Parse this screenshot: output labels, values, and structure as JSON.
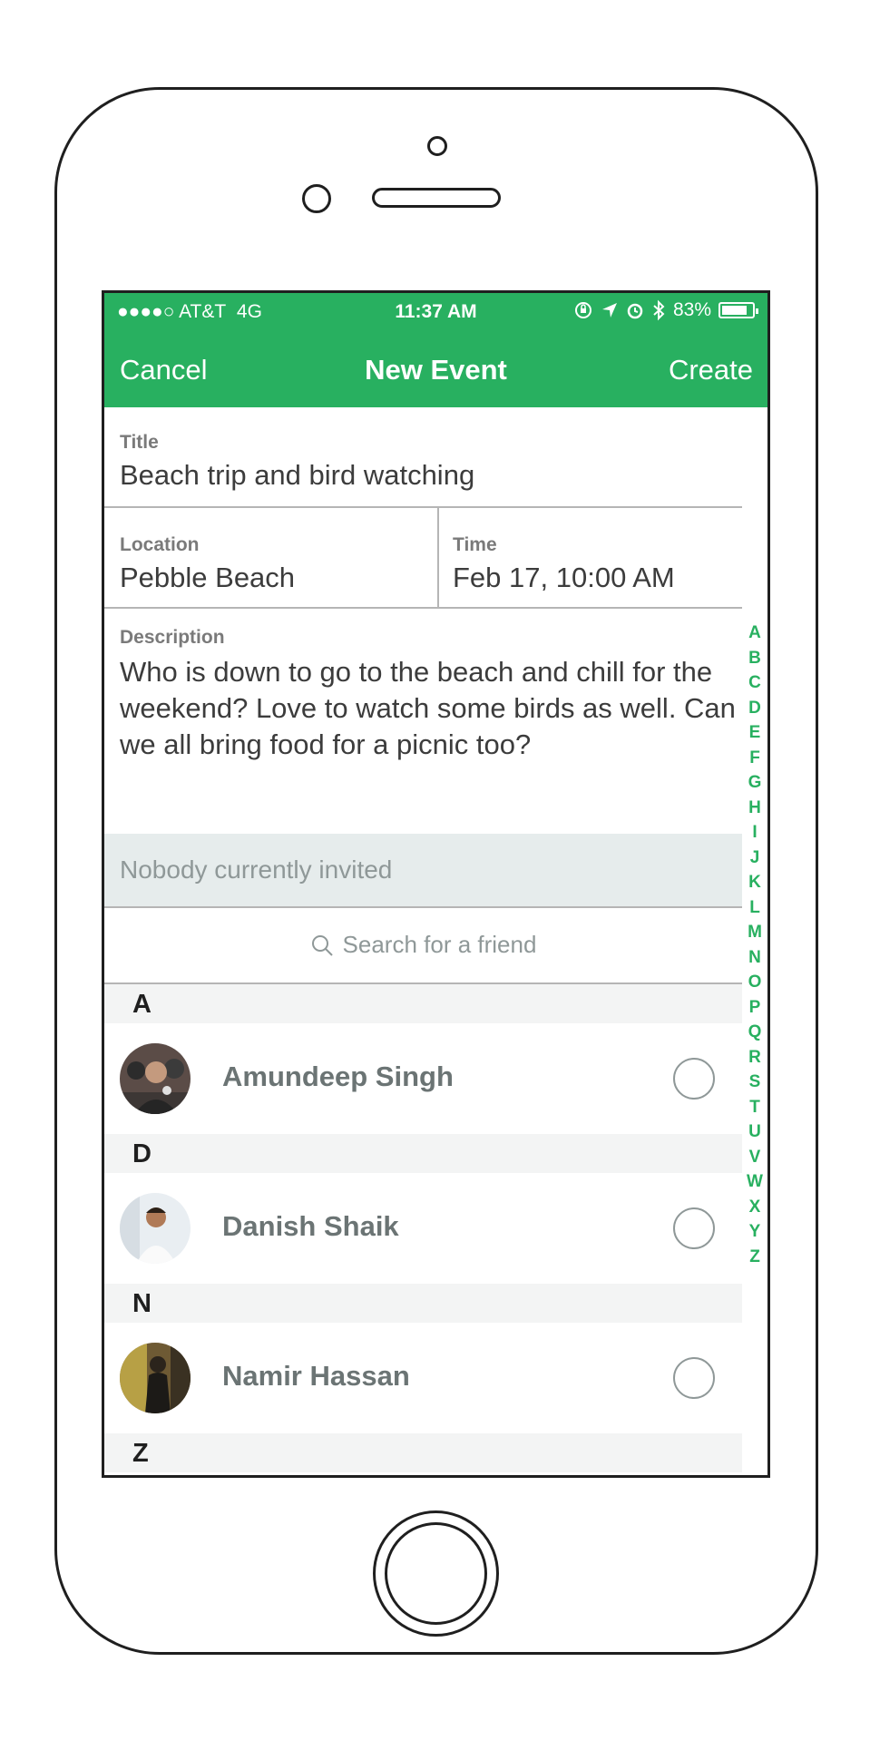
{
  "status_bar": {
    "carrier": "●●●●○ AT&T",
    "network": "4G",
    "time": "11:37 AM",
    "battery": "83%",
    "battery_level": 0.83,
    "icons": [
      "rotation-lock-icon",
      "location-arrow-icon",
      "alarm-icon",
      "bluetooth-icon",
      "battery-icon"
    ]
  },
  "nav": {
    "cancel_label": "Cancel",
    "title": "New Event",
    "create_label": "Create"
  },
  "form": {
    "title_label": "Title",
    "title_value": "Beach trip and bird watching",
    "location_label": "Location",
    "location_value": "Pebble Beach",
    "time_label": "Time",
    "time_value": "Feb 17, 10:00 AM",
    "description_label": "Description",
    "description_value": "Who is down to go to the beach and chill for the weekend? Love to watch some birds as well. Can we all bring food for a picnic too?"
  },
  "invited_text": "Nobody currently invited",
  "search": {
    "placeholder": "Search for a friend"
  },
  "sections": [
    {
      "letter": "A",
      "contacts": [
        {
          "name": "Amundeep Singh",
          "selected": false
        }
      ]
    },
    {
      "letter": "D",
      "contacts": [
        {
          "name": "Danish Shaik",
          "selected": false
        }
      ]
    },
    {
      "letter": "N",
      "contacts": [
        {
          "name": "Namir Hassan",
          "selected": false
        }
      ]
    },
    {
      "letter": "Z",
      "contacts": []
    }
  ],
  "index_letters": [
    "A",
    "B",
    "C",
    "D",
    "E",
    "F",
    "G",
    "H",
    "I",
    "J",
    "K",
    "L",
    "M",
    "N",
    "O",
    "P",
    "Q",
    "R",
    "S",
    "T",
    "U",
    "V",
    "W",
    "X",
    "Y",
    "Z"
  ],
  "colors": {
    "accent": "#28b060",
    "section_bg": "#f3f4f4",
    "invited_bg": "#e6ecec",
    "name_text": "#6b7474"
  }
}
